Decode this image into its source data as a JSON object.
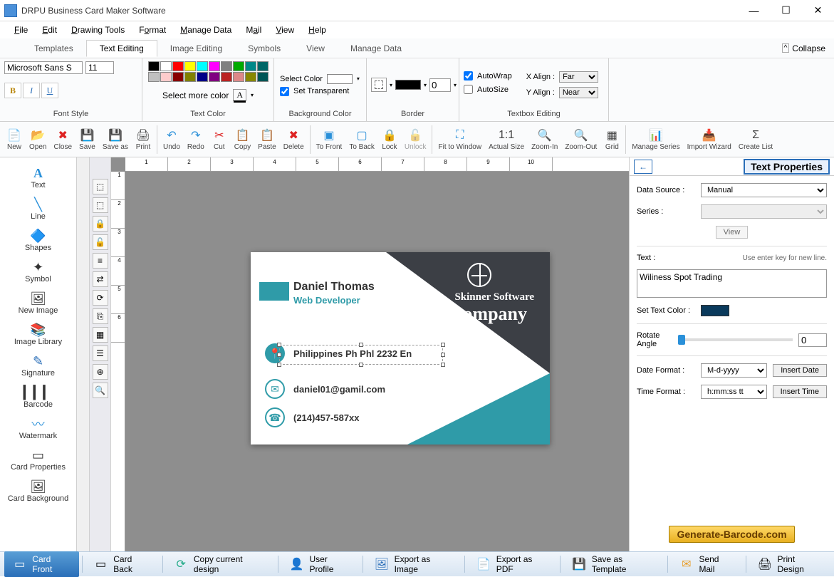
{
  "window": {
    "title": "DRPU Business Card Maker Software"
  },
  "menubar": {
    "file": "File",
    "edit": "Edit",
    "drawing": "Drawing Tools",
    "format": "Format",
    "manage": "Manage Data",
    "mail": "Mail",
    "view": "View",
    "help": "Help"
  },
  "tabs": {
    "templates": "Templates",
    "textedit": "Text Editing",
    "imageedit": "Image Editing",
    "symbols": "Symbols",
    "view": "View",
    "managedata": "Manage Data",
    "collapse": "Collapse"
  },
  "ribbon": {
    "fontstyle_label": "Font Style",
    "fontname": "Microsoft Sans S",
    "fontsize": "11",
    "bold": "B",
    "italic": "I",
    "underline": "U",
    "textcolor_label": "Text Color",
    "morecolor": "Select more color",
    "A": "A",
    "bgcolor_label": "Background Color",
    "selectcolor": "Select Color",
    "settrans": "Set Transparent",
    "border_label": "Border",
    "border_size": "0",
    "textbox_label": "Textbox Editing",
    "autowrap": "AutoWrap",
    "autosize": "AutoSize",
    "xalign": "X Align :",
    "yalign": "Y Align :",
    "xval": "Far",
    "yval": "Near"
  },
  "toolbar": {
    "new": "New",
    "open": "Open",
    "close": "Close",
    "save": "Save",
    "saveas": "Save as",
    "print": "Print",
    "undo": "Undo",
    "redo": "Redo",
    "cut": "Cut",
    "copy": "Copy",
    "paste": "Paste",
    "delete": "Delete",
    "tofront": "To Front",
    "toback": "To Back",
    "lock": "Lock",
    "unlock": "Unlock",
    "fit": "Fit to Window",
    "actual": "Actual Size",
    "zoomin": "Zoom-In",
    "zoomout": "Zoom-Out",
    "grid": "Grid",
    "series": "Manage Series",
    "wizard": "Import Wizard",
    "createlist": "Create List"
  },
  "lefttools": {
    "text": "Text",
    "line": "Line",
    "shapes": "Shapes",
    "symbol": "Symbol",
    "newimage": "New Image",
    "imagelib": "Image Library",
    "signature": "Signature",
    "barcode": "Barcode",
    "watermark": "Watermark",
    "cardprops": "Card Properties",
    "cardbg": "Card Background"
  },
  "card": {
    "name": "Daniel Thomas",
    "role": "Web Developer",
    "company1": "Skinner Software",
    "company2": "Company",
    "location": "Philippines Ph Phl 2232 En",
    "email": "daniel01@gamil.com",
    "phone": "(214)457-587xx"
  },
  "props": {
    "title": "Text Properties",
    "datasource_l": "Data Source :",
    "datasource_v": "Manual",
    "series_l": "Series :",
    "view_btn": "View",
    "text_l": "Text :",
    "text_hint": "Use enter key for new line.",
    "text_val": "Wiliness Spot Trading",
    "setcolor_l": "Set Text Color :",
    "rotate_l": "Rotate Angle",
    "rotate_v": "0",
    "dateformat_l": "Date Format :",
    "dateformat_v": "M-d-yyyy",
    "insertdate": "Insert Date",
    "timeformat_l": "Time Format :",
    "timeformat_v": "h:mm:ss tt",
    "inserttime": "Insert Time"
  },
  "brand": "Generate-Barcode.com",
  "bottom": {
    "cardfront": "Card Front",
    "cardback": "Card Back",
    "copy": "Copy current design",
    "user": "User Profile",
    "exportimg": "Export as Image",
    "exportpdf": "Export as PDF",
    "savetpl": "Save as Template",
    "sendmail": "Send Mail",
    "print": "Print Design"
  },
  "ruler_nums": [
    "1",
    "2",
    "3",
    "4",
    "5",
    "6",
    "7",
    "8",
    "9",
    "10"
  ],
  "ruler_v": [
    "1",
    "2",
    "3",
    "4",
    "5",
    "6"
  ],
  "colors1": [
    "#000",
    "#fff",
    "#f00",
    "#ff0",
    "#0ff",
    "#f0f",
    "#808080",
    "#0a0",
    "#088",
    "#066"
  ],
  "colors2": [
    "#c0c0c0",
    "#fcc",
    "#800",
    "#808000",
    "#008",
    "#800080",
    "#b22",
    "#d88",
    "#880",
    "#055"
  ]
}
